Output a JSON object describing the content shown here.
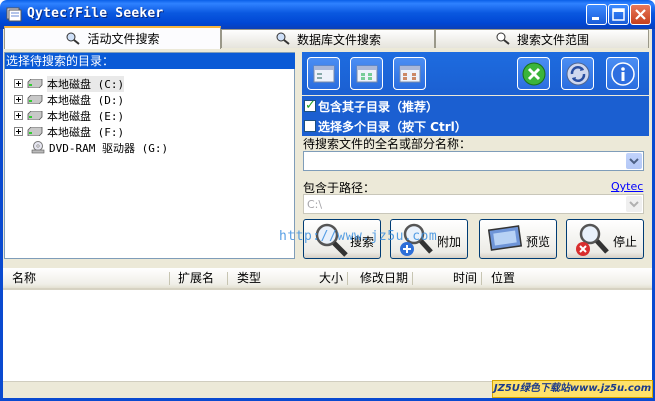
{
  "window": {
    "title": "Qytec?File Seeker"
  },
  "tabs": [
    {
      "label": "活动文件搜索",
      "active": true
    },
    {
      "label": "数据库文件搜索",
      "active": false
    },
    {
      "label": "搜索文件范围",
      "active": false
    }
  ],
  "tree": {
    "header": "选择待搜索的目录：",
    "items": [
      {
        "label": "本地磁盘 (C:)",
        "type": "hdd",
        "expandable": true,
        "selected": true
      },
      {
        "label": "本地磁盘 (D:)",
        "type": "hdd",
        "expandable": true,
        "selected": false
      },
      {
        "label": "本地磁盘 (E:)",
        "type": "hdd",
        "expandable": true,
        "selected": false
      },
      {
        "label": "本地磁盘 (F:)",
        "type": "hdd",
        "expandable": true,
        "selected": false
      },
      {
        "label": "DVD-RAM 驱动器 (G:)",
        "type": "dvd",
        "expandable": false,
        "selected": false
      }
    ]
  },
  "options": {
    "include_subdirs": {
      "label": "包含其子目录（推荐）",
      "checked": true
    },
    "multi_dirs": {
      "label": "选择多个目录（按下 Ctrl）",
      "checked": false
    }
  },
  "search": {
    "name_label": "待搜索文件的全名或部分名称：",
    "name_value": "",
    "path_label": "包含于路径：",
    "path_value": "C:\\",
    "link_label": "Qytec"
  },
  "actions": {
    "search": "搜索",
    "add": "附加",
    "preview": "预览",
    "stop": "停止"
  },
  "watermark_url": "http://www.jz5u.com",
  "columns": [
    "名称",
    "扩展名",
    "类型",
    "大小",
    "修改日期",
    "时间",
    "位置"
  ],
  "badge": "JZ5U绿色下载站www.jz5u.com",
  "colors": {
    "titlebar": "#0a58e0",
    "accent_blue": "#1b5fd1",
    "frame": "#ece9d8"
  }
}
